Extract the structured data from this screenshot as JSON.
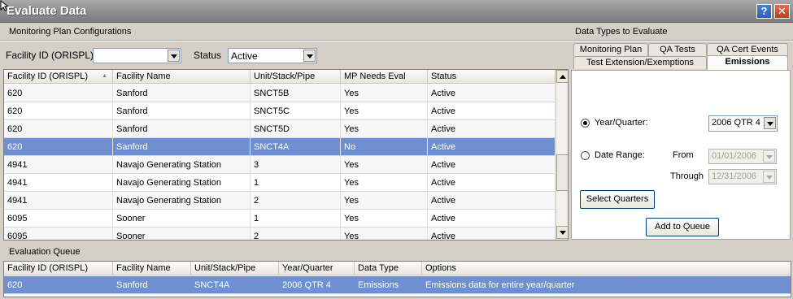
{
  "window": {
    "title": "Evaluate Data",
    "help_glyph": "?",
    "close_glyph": "✕"
  },
  "labels": {
    "monitoring_plan_configurations": "Monitoring Plan Configurations",
    "data_types_to_evaluate": "Data Types to Evaluate",
    "facility_id": "Facility ID (ORISPL)",
    "status": "Status",
    "evaluation_queue": "Evaluation Queue"
  },
  "filters": {
    "facility_id_value": "",
    "status_value": "Active"
  },
  "mp_grid": {
    "columns": [
      "Facility ID (ORISPL)",
      "Facility Name",
      "Unit/Stack/Pipe",
      "MP Needs Eval",
      "Status"
    ],
    "rows": [
      [
        "620",
        "Sanford",
        "SNCT5B",
        "Yes",
        "Active"
      ],
      [
        "620",
        "Sanford",
        "SNCT5C",
        "Yes",
        "Active"
      ],
      [
        "620",
        "Sanford",
        "SNCT5D",
        "Yes",
        "Active"
      ],
      [
        "620",
        "Sanford",
        "SNCT4A",
        "No",
        "Active"
      ],
      [
        "4941",
        "Navajo Generating Station",
        "3",
        "Yes",
        "Active"
      ],
      [
        "4941",
        "Navajo Generating Station",
        "1",
        "Yes",
        "Active"
      ],
      [
        "4941",
        "Navajo Generating Station",
        "2",
        "Yes",
        "Active"
      ],
      [
        "6095",
        "Sooner",
        "1",
        "Yes",
        "Active"
      ],
      [
        "6095",
        "Sooner",
        "2",
        "Yes",
        "Active"
      ]
    ],
    "selected_row": 3
  },
  "tabs": {
    "row1": [
      "Monitoring Plan",
      "QA Tests",
      "QA Cert Events"
    ],
    "row2": [
      "Test Extension/Exemptions",
      "Emissions"
    ],
    "active": "Emissions"
  },
  "emissions": {
    "year_quarter_label": "Year/Quarter:",
    "year_quarter_value": "2006 QTR 4",
    "date_range_label": "Date Range:",
    "from_label": "From",
    "from_value": "01/01/2006",
    "through_label": "Through",
    "through_value": "12/31/2006",
    "select_quarters_button": "Select Quarters",
    "add_to_queue_button": "Add to Queue"
  },
  "queue_grid": {
    "columns": [
      "Facility ID (ORISPL)",
      "Facility Name",
      "Unit/Stack/Pipe",
      "Year/Quarter",
      "Data Type",
      "Options"
    ],
    "rows": [
      [
        "620",
        "Sanford",
        "SNCT4A",
        "2006 QTR 4",
        "Emissions",
        "Emissions data for entire year/quarter"
      ]
    ]
  },
  "colors": {
    "selection": "#6f8fd0",
    "titlebar": "#8e8e8e"
  }
}
